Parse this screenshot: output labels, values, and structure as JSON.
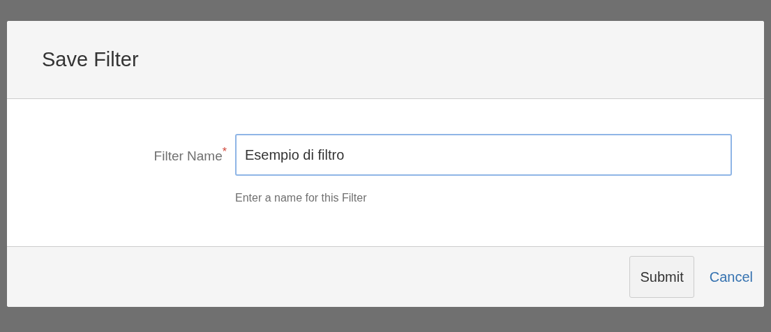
{
  "dialog": {
    "title": "Save Filter",
    "field": {
      "label": "Filter Name",
      "required_mark": "*",
      "value": "Esempio di filtro",
      "focused": true,
      "help": "Enter a name for this Filter"
    },
    "buttons": [
      {
        "kind": "button",
        "label": "Submit"
      },
      {
        "kind": "link",
        "label": "Cancel"
      }
    ]
  }
}
